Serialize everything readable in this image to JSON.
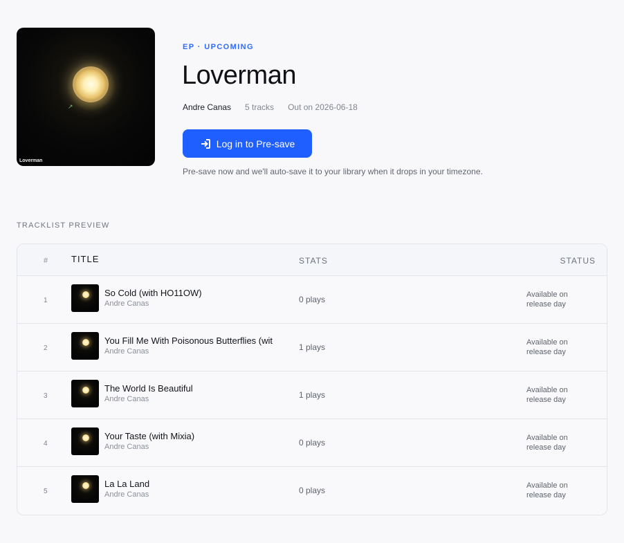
{
  "release": {
    "eyebrow": "EP · UPCOMING",
    "title": "Loverman",
    "artist": "Andre Canas",
    "track_count": "5 tracks",
    "release_date": "Out on 2026-06-18",
    "cover_text": "Loverman"
  },
  "presave": {
    "button_label": "Log in to Pre-save",
    "note": "Pre-save now and we'll auto-save it to your library when it drops in your timezone."
  },
  "tracklist": {
    "section_label": "TRACKLIST PREVIEW",
    "headers": {
      "num": "#",
      "title": "TITLE",
      "stats": "STATS",
      "status": "STATUS"
    },
    "tracks": [
      {
        "num": "1",
        "title": "So Cold (with HO11OW)",
        "artist": "Andre Canas",
        "plays": "0 plays",
        "status": "Available on release day"
      },
      {
        "num": "2",
        "title": "You Fill Me With Poisonous Butterflies (wit",
        "artist": "Andre Canas",
        "plays": "1 plays",
        "status": "Available on release day"
      },
      {
        "num": "3",
        "title": "The World Is Beautiful",
        "artist": "Andre Canas",
        "plays": "1 plays",
        "status": "Available on release day"
      },
      {
        "num": "4",
        "title": "Your Taste (with Mixia)",
        "artist": "Andre Canas",
        "plays": "0 plays",
        "status": "Available on release day"
      },
      {
        "num": "5",
        "title": "La La Land",
        "artist": "Andre Canas",
        "plays": "0 plays",
        "status": "Available on release day"
      }
    ]
  },
  "icons": {
    "login": "login-arrow-icon",
    "sparkle": "sparkle-icon"
  },
  "colors": {
    "accent": "#1f5eff",
    "eyebrow": "#2f6bff"
  }
}
